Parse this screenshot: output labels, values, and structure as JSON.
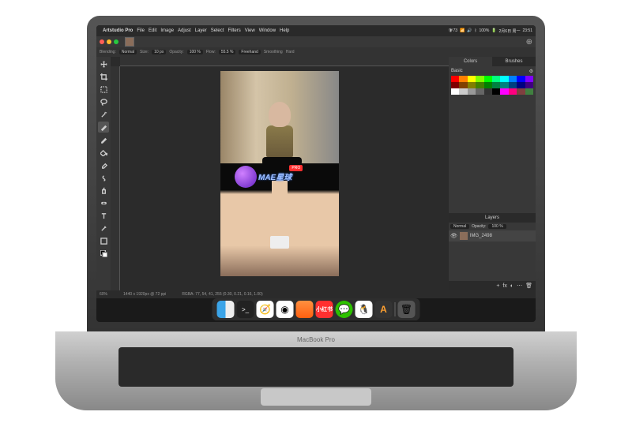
{
  "menubar": {
    "app": "Artstudio Pro",
    "items": [
      "File",
      "Edit",
      "Image",
      "Adjust",
      "Layer",
      "Select",
      "Filters",
      "View",
      "Window",
      "Help"
    ],
    "battery": "100%",
    "date": "2月6日 周一",
    "time": "23:51",
    "notif": "73"
  },
  "optionbar": {
    "blending_lbl": "Blending:",
    "blending": "Normal",
    "size_lbl": "Size:",
    "size": "10 px",
    "opacity_lbl": "Opacity:",
    "opacity": "100 %",
    "flow_lbl": "Flow:",
    "flow": "55.5 %",
    "freehand": "Freehand",
    "smoothing": "Smoothing",
    "hard": "Hard"
  },
  "panels": {
    "colors_tab": "Colors",
    "brushes_tab": "Brushes",
    "basic_lbl": "Basic",
    "layers_hdr": "Layers",
    "layer_mode": "Normal",
    "layer_op_lbl": "Opacity:",
    "layer_op": "100 %",
    "layer_name": "IMG_2498"
  },
  "status": {
    "zoom": "60%",
    "dims": "1440 x 1920px @ 72 ppi",
    "rgba": "RGBA: 77, 54, 41, 255 (0.30, 0.21, 0.16, 1.00)"
  },
  "watermark": {
    "text": "MAE星球",
    "badge": "PRO"
  },
  "laptop_label": "MacBook Pro",
  "swatches": [
    [
      "#ff0000",
      "#ff8000",
      "#ffff00",
      "#80ff00",
      "#00ff00",
      "#00ff80",
      "#00ffff",
      "#0080ff",
      "#0000ff",
      "#8000ff"
    ],
    [
      "#800000",
      "#804000",
      "#808000",
      "#408000",
      "#008000",
      "#008040",
      "#008080",
      "#004080",
      "#000080",
      "#400080"
    ],
    [
      "#ffffff",
      "#cccccc",
      "#999999",
      "#666666",
      "#333333",
      "#000000",
      "#ff00ff",
      "#ff0080",
      "#804040",
      "#408040"
    ]
  ],
  "dock": [
    "finder",
    "term",
    "safari",
    "chrome",
    "orange",
    "red",
    "wechat",
    "qq",
    "a",
    "trash"
  ],
  "red_label": "小红书"
}
